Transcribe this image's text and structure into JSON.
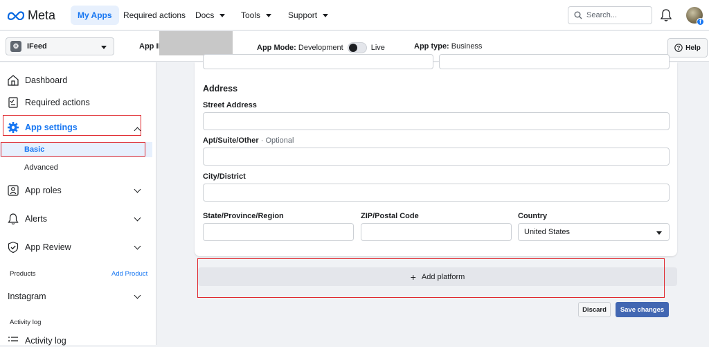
{
  "header": {
    "logo_text": "Meta",
    "nav": [
      {
        "label": "My Apps",
        "active": true
      },
      {
        "label": "Required actions"
      },
      {
        "label": "Docs"
      },
      {
        "label": "Tools"
      },
      {
        "label": "Support"
      }
    ],
    "search_placeholder": "Search..."
  },
  "subbar": {
    "app_name": "IFeed",
    "app_id_label": "App ID",
    "app_mode_label": "App Mode:",
    "app_mode_value": "Development",
    "live_label": "Live",
    "app_type_label": "App type:",
    "app_type_value": "Business",
    "help_label": "Help"
  },
  "sidebar": {
    "dashboard": "Dashboard",
    "required_actions": "Required actions",
    "app_settings": "App settings",
    "basic": "Basic",
    "advanced": "Advanced",
    "app_roles": "App roles",
    "alerts": "Alerts",
    "app_review": "App Review",
    "products_label": "Products",
    "add_product": "Add Product",
    "instagram": "Instagram",
    "activity_log_label": "Activity log",
    "activity_log_item": "Activity log"
  },
  "form": {
    "address_title": "Address",
    "street_label": "Street Address",
    "apt_label": "Apt/Suite/Other",
    "apt_optional": "· Optional",
    "city_label": "City/District",
    "state_label": "State/Province/Region",
    "zip_label": "ZIP/Postal Code",
    "country_label": "Country",
    "country_value": "United States"
  },
  "actions": {
    "add_platform": "Add platform",
    "discard": "Discard",
    "save": "Save changes"
  },
  "colors": {
    "accent": "#1877f2",
    "save_button": "#4267b2",
    "highlight_box": "#e0282e"
  }
}
